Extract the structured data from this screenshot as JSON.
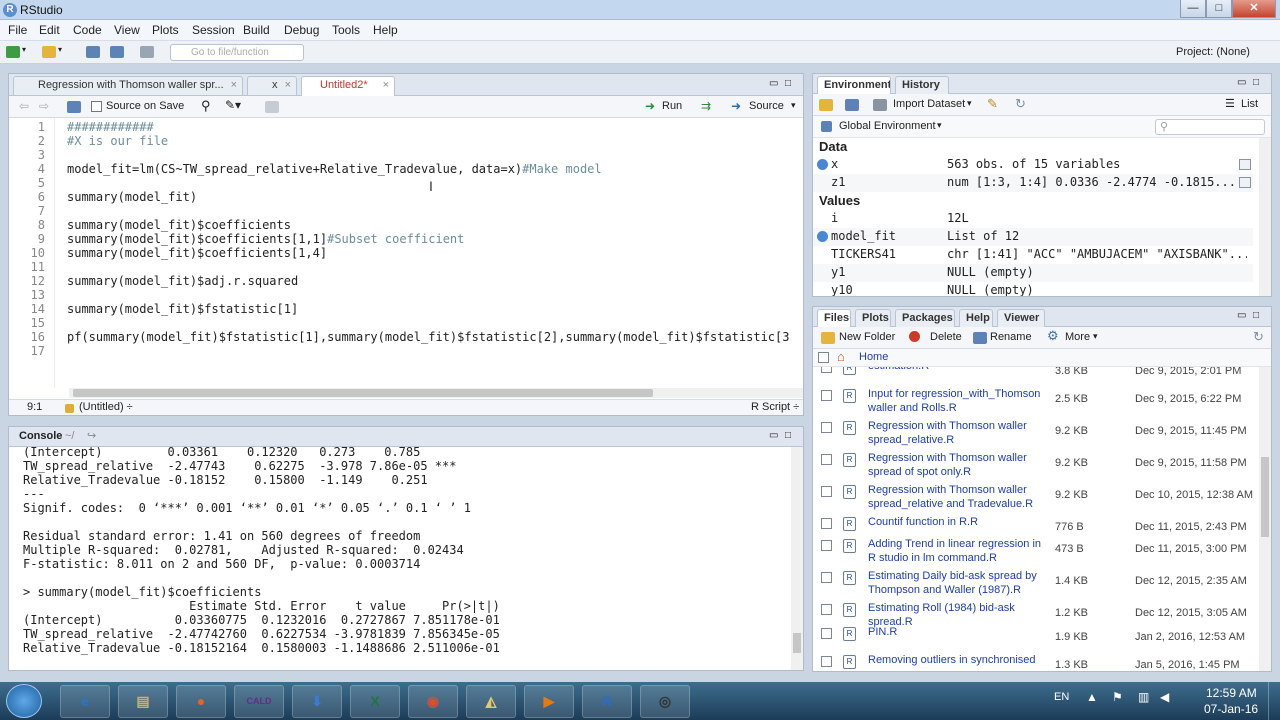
{
  "window": {
    "title": "RStudio",
    "minimize": "—",
    "maximize": "□",
    "close": "✕"
  },
  "menu": [
    "File",
    "Edit",
    "Code",
    "View",
    "Plots",
    "Session",
    "Build",
    "Debug",
    "Tools",
    "Help"
  ],
  "toolbar": {
    "go_to_file_placeholder": "Go to file/function",
    "project": "Project: (None)"
  },
  "editor": {
    "tabs": [
      {
        "label": "Regression with Thomson waller spr...",
        "active": false
      },
      {
        "label": "x",
        "active": false
      },
      {
        "label": "Untitled2*",
        "active": true
      }
    ],
    "source_on_save": "Source on Save",
    "run": "Run",
    "source": "Source",
    "lines": [
      {
        "n": "1",
        "segments": [
          {
            "t": "############",
            "c": "cmt"
          }
        ]
      },
      {
        "n": "2",
        "segments": [
          {
            "t": "#X is our file",
            "c": "cmt"
          }
        ]
      },
      {
        "n": "3",
        "segments": []
      },
      {
        "n": "4",
        "segments": [
          {
            "t": "model_fit=lm(CS~TW_spread_relative+Relative_Tradevalue, data=x)",
            "c": ""
          },
          {
            "t": "#Make model",
            "c": "cmt"
          }
        ]
      },
      {
        "n": "5",
        "segments": []
      },
      {
        "n": "6",
        "segments": [
          {
            "t": "summary(model_fit)",
            "c": ""
          }
        ]
      },
      {
        "n": "7",
        "segments": []
      },
      {
        "n": "8",
        "segments": [
          {
            "t": "summary(model_fit)$coefficients",
            "c": ""
          }
        ]
      },
      {
        "n": "9",
        "segments": [
          {
            "t": "summary(model_fit)$coefficients[1,1]",
            "c": ""
          },
          {
            "t": "#Subset coefficient",
            "c": "cmt"
          }
        ]
      },
      {
        "n": "10",
        "segments": [
          {
            "t": "summary(model_fit)$coefficients[1,4]",
            "c": ""
          }
        ]
      },
      {
        "n": "11",
        "segments": []
      },
      {
        "n": "12",
        "segments": [
          {
            "t": "summary(model_fit)$adj.r.squared",
            "c": ""
          }
        ]
      },
      {
        "n": "13",
        "segments": []
      },
      {
        "n": "14",
        "segments": [
          {
            "t": "summary(model_fit)$fstatistic[1]",
            "c": ""
          }
        ]
      },
      {
        "n": "15",
        "segments": []
      },
      {
        "n": "16",
        "segments": [
          {
            "t": "pf(summary(model_fit)$fstatistic[1],summary(model_fit)$fstatistic[2],summary(model_fit)$fstatistic[3",
            "c": ""
          }
        ]
      },
      {
        "n": "17",
        "segments": []
      }
    ],
    "status_pos": "9:1",
    "status_scope": "(Untitled) ÷",
    "status_type": "R Script ÷"
  },
  "console": {
    "title": "Console",
    "path": "~/",
    "lines": [
      {
        "t": "(Intercept)         0.03361    0.12320   0.273    0.785",
        "c": ""
      },
      {
        "t": "TW_spread_relative  -2.47743    0.62275  -3.978 7.86e-05 ***",
        "c": ""
      },
      {
        "t": "Relative_Tradevalue -0.18152    0.15800  -1.149    0.251",
        "c": ""
      },
      {
        "t": "---",
        "c": ""
      },
      {
        "t": "Signif. codes:  0 ‘***’ 0.001 ‘**’ 0.01 ‘*’ 0.05 ‘.’ 0.1 ‘ ’ 1",
        "c": ""
      },
      {
        "t": "",
        "c": ""
      },
      {
        "t": "Residual standard error: 1.41 on 560 degrees of freedom",
        "c": ""
      },
      {
        "t": "Multiple R-squared:  0.02781,    Adjusted R-squared:  0.02434",
        "c": ""
      },
      {
        "t": "F-statistic: 8.011 on 2 and 560 DF,  p-value: 0.0003714",
        "c": ""
      },
      {
        "t": "",
        "c": ""
      },
      {
        "t": "> summary(model_fit)$coefficients",
        "c": "blue"
      },
      {
        "t": "                       Estimate Std. Error    t value     Pr(>|t|)",
        "c": ""
      },
      {
        "t": "(Intercept)          0.03360775  0.1232016  0.2727867 7.851178e-01",
        "c": ""
      },
      {
        "t": "TW_spread_relative  -2.47742760  0.6227534 -3.9781839 7.856345e-05",
        "c": ""
      },
      {
        "t": "Relative_Tradevalue -0.18152164  0.1580003 -1.1488686 2.511006e-01",
        "c": ""
      },
      {
        "t": "",
        "c": ""
      },
      {
        "t": "> |",
        "c": "blue"
      }
    ]
  },
  "environment": {
    "tabs": [
      "Environment",
      "History"
    ],
    "import_dataset": "Import Dataset",
    "list_view": "List",
    "scope": "Global Environment",
    "sections": {
      "data": "Data",
      "values": "Values"
    },
    "data_rows": [
      {
        "name": "x",
        "value": "563 obs. of 15 variables",
        "expand": true
      },
      {
        "name": "z1",
        "value": "num [1:3, 1:4] 0.0336 -2.4774 -0.1815...",
        "expand": false
      }
    ],
    "value_rows": [
      {
        "name": "i",
        "value": "12L",
        "expand": false
      },
      {
        "name": "model_fit",
        "value": "List of 12",
        "expand": true
      },
      {
        "name": "TICKERS41",
        "value": "chr [1:41] \"ACC\" \"AMBUJACEM\" \"AXISBANK\"...",
        "expand": false
      },
      {
        "name": "y1",
        "value": "NULL (empty)",
        "expand": false
      },
      {
        "name": "y10",
        "value": "NULL (empty)",
        "expand": false
      }
    ]
  },
  "files": {
    "tabs": [
      "Files",
      "Plots",
      "Packages",
      "Help",
      "Viewer"
    ],
    "new_folder": "New Folder",
    "delete": "Delete",
    "rename": "Rename",
    "more": "More",
    "home": "Home",
    "items": [
      {
        "name": "estimation.R",
        "size": "3.8 KB",
        "date": "Dec 9, 2015, 2:01 PM"
      },
      {
        "name": "Input for regression_with_Thomson waller and Rolls.R",
        "size": "2.5 KB",
        "date": "Dec 9, 2015, 6:22 PM"
      },
      {
        "name": "Regression with Thomson waller spread_relative.R",
        "size": "9.2 KB",
        "date": "Dec 9, 2015, 11:45 PM"
      },
      {
        "name": "Regression with Thomson waller spread of spot only.R",
        "size": "9.2 KB",
        "date": "Dec 9, 2015, 11:58 PM"
      },
      {
        "name": "Regression with Thomson waller spread_relative and Tradevalue.R",
        "size": "9.2 KB",
        "date": "Dec 10, 2015, 12:38 AM"
      },
      {
        "name": "Countif function in R.R",
        "size": "776 B",
        "date": "Dec 11, 2015, 2:43 PM"
      },
      {
        "name": "Adding Trend in linear regression in R studio in lm command.R",
        "size": "473 B",
        "date": "Dec 11, 2015, 3:00 PM"
      },
      {
        "name": "Estimating Daily bid-ask spread by Thompson and Waller (1987).R",
        "size": "1.4 KB",
        "date": "Dec 12, 2015, 2:35 AM"
      },
      {
        "name": "Estimating Roll (1984) bid-ask spread.R",
        "size": "1.2 KB",
        "date": "Dec 12, 2015, 3:05 AM"
      },
      {
        "name": "PIN.R",
        "size": "1.9 KB",
        "date": "Jan 2, 2016, 12:53 AM"
      },
      {
        "name": "Removing outliers in synchronised",
        "size": "1.3 KB",
        "date": "Jan 5, 2016, 1:45 PM"
      }
    ]
  },
  "taskbar": {
    "lang": "EN",
    "time": "12:59 AM",
    "date": "07-Jan-16",
    "apps": [
      "e",
      "▤",
      "●",
      "CALD",
      "⬇",
      "X",
      "◉",
      "◭",
      "▶",
      "R",
      "◎"
    ]
  }
}
